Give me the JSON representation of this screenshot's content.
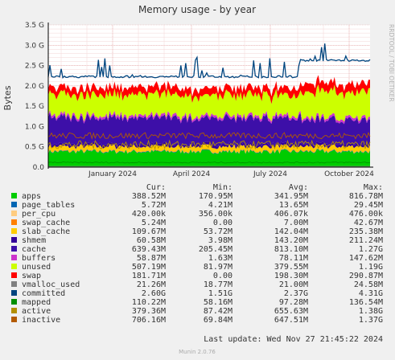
{
  "chart_data": {
    "type": "area",
    "title": "Memory usage - by year",
    "ylabel": "Bytes",
    "watermark": "RRDTOOL / TOBI OETIKER",
    "ylim": [
      0,
      3.5
    ],
    "y_unit": "G",
    "yticks": [
      "0.0",
      "0.5 G",
      "1.0 G",
      "1.5 G",
      "2.0 G",
      "2.5 G",
      "3.0 G",
      "3.5 G"
    ],
    "xticks": [
      "January 2024",
      "April 2024",
      "July 2024",
      "October 2024"
    ],
    "grid": true,
    "stack_approx_G": {
      "apps": 0.38,
      "page_tables": 0.01,
      "per_cpu": 0.0,
      "swap_cache": 0.01,
      "slab_cache": 0.11,
      "shmem": 0.06,
      "cache": 0.64,
      "buffers": 0.06,
      "unused": 0.5,
      "swap": 0.18
    },
    "committed_level_G": [
      2.2,
      2.6
    ],
    "columns": [
      "Cur:",
      "Min:",
      "Avg:",
      "Max:"
    ],
    "series": [
      {
        "name": "apps",
        "color": "#00cc00",
        "cur": "388.52M",
        "min": "170.95M",
        "avg": "341.95M",
        "max": "816.78M"
      },
      {
        "name": "page_tables",
        "color": "#0066b3",
        "cur": "5.72M",
        "min": "4.21M",
        "avg": "13.65M",
        "max": "29.45M"
      },
      {
        "name": "per_cpu",
        "color": "#ffcc80",
        "cur": "420.00k",
        "min": "356.00k",
        "avg": "406.07k",
        "max": "476.00k"
      },
      {
        "name": "swap_cache",
        "color": "#ff8000",
        "cur": "5.24M",
        "min": "0.00",
        "avg": "7.00M",
        "max": "42.67M"
      },
      {
        "name": "slab_cache",
        "color": "#ffcc00",
        "cur": "109.67M",
        "min": "53.72M",
        "avg": "142.04M",
        "max": "235.38M"
      },
      {
        "name": "shmem",
        "color": "#330099",
        "cur": "60.58M",
        "min": "3.98M",
        "avg": "143.20M",
        "max": "211.24M"
      },
      {
        "name": "cache",
        "color": "#3d0fa8",
        "cur": "639.43M",
        "min": "205.45M",
        "avg": "813.10M",
        "max": "1.27G"
      },
      {
        "name": "buffers",
        "color": "#cc33cc",
        "cur": "58.87M",
        "min": "1.63M",
        "avg": "78.11M",
        "max": "147.62M"
      },
      {
        "name": "unused",
        "color": "#ccff00",
        "cur": "507.19M",
        "min": "81.97M",
        "avg": "379.55M",
        "max": "1.19G"
      },
      {
        "name": "swap",
        "color": "#ff0000",
        "cur": "181.71M",
        "min": "0.00",
        "avg": "198.30M",
        "max": "290.87M"
      },
      {
        "name": "vmalloc_used",
        "color": "#808080",
        "cur": "21.26M",
        "min": "18.77M",
        "avg": "21.00M",
        "max": "24.58M"
      },
      {
        "name": "committed",
        "color": "#00457f",
        "cur": "2.60G",
        "min": "1.51G",
        "avg": "2.37G",
        "max": "4.31G"
      },
      {
        "name": "mapped",
        "color": "#008f00",
        "cur": "110.22M",
        "min": "58.16M",
        "avg": "97.28M",
        "max": "136.54M"
      },
      {
        "name": "active",
        "color": "#b38f00",
        "cur": "379.36M",
        "min": "87.42M",
        "avg": "655.63M",
        "max": "1.38G"
      },
      {
        "name": "inactive",
        "color": "#b35a00",
        "cur": "706.16M",
        "min": "69.84M",
        "avg": "647.51M",
        "max": "1.37G"
      }
    ],
    "last_update": "Last update: Wed Nov 27 21:45:22 2024",
    "footer": "Munin 2.0.76"
  }
}
